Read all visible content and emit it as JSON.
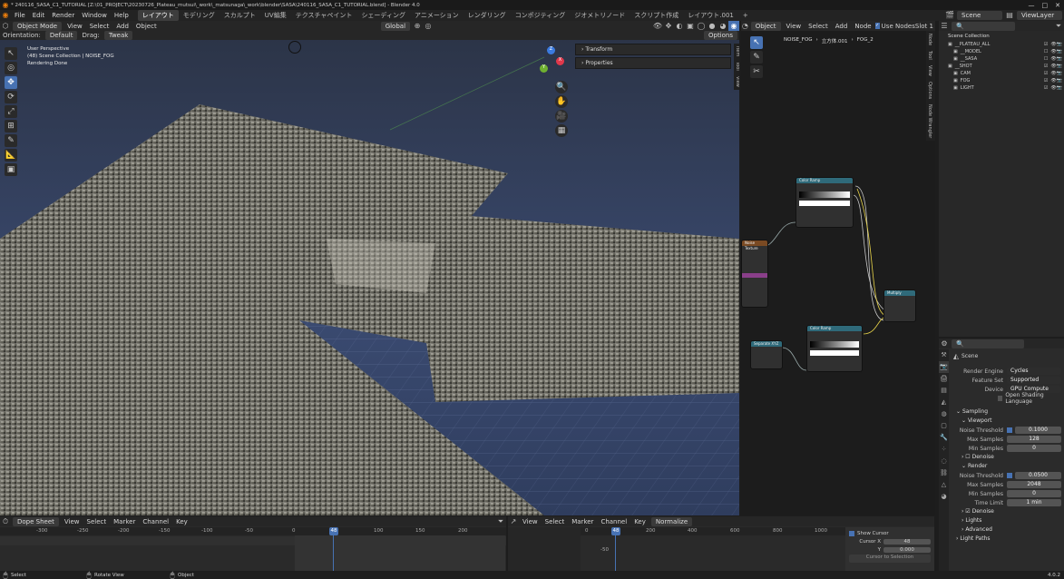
{
  "window_title": "* 240116_SASA_C1_TUTORIAL [Z:\\01_PROJECT\\20230726_Plateau_mutsui\\_work\\_matsunaga\\_work\\blender\\SASA\\240116_SASA_C1_TUTORIAL.blend] - Blender 4.0",
  "menu": [
    "File",
    "Edit",
    "Render",
    "Window",
    "Help"
  ],
  "workspaces": [
    "レイアウト",
    "モデリング",
    "スカルプト",
    "UV編集",
    "テクスチャペイント",
    "シェーディング",
    "アニメーション",
    "レンダリング",
    "コンポジティング",
    "ジオメトリノード",
    "スクリプト作成",
    "レイアウト.001"
  ],
  "active_workspace": "レイアウト",
  "add_ws": "+",
  "scene_name": "Scene",
  "view_layer": "ViewLayer",
  "viewport": {
    "mode": "Object Mode",
    "menus": [
      "View",
      "Select",
      "Add",
      "Object"
    ],
    "orientation_label": "Orientation:",
    "orientation": "Default",
    "drag_label": "Drag:",
    "drag": "Tweak",
    "transform_orient": "Global",
    "options": "Options",
    "info": [
      "User Perspective",
      "(48) Scene Collection | NOISE_FOG",
      "Rendering Done"
    ],
    "n_panels": [
      "Transform",
      "Properties"
    ],
    "side_tabs": [
      "Item",
      "Tool",
      "View"
    ],
    "tools": [
      "↖",
      "◎",
      "✥",
      "⟳",
      "⤢",
      "⊞",
      "✎",
      "📐",
      "▣"
    ],
    "gizmo": {
      "x": "X",
      "y": "Y",
      "z": "Z"
    },
    "nav": [
      "🔍",
      "✋",
      "🎥",
      "▦"
    ]
  },
  "node_editor": {
    "type": "Object",
    "menus": [
      "View",
      "Select",
      "Add",
      "Node"
    ],
    "use_nodes": "Use Nodes",
    "slot": "Slot 1",
    "breadcrumb": [
      "NOISE_FOG",
      "立方体.001",
      "FOG_2"
    ],
    "side_tabs": [
      "Node",
      "Tool",
      "View",
      "Options",
      "Node Wrangler"
    ],
    "nodes": [
      {
        "id": "cr1",
        "title": "Color Ramp",
        "color": "#2f6a7a"
      },
      {
        "id": "cr2",
        "title": "Color Ramp",
        "color": "#2f6a7a"
      },
      {
        "id": "noise",
        "title": "Noise Texture",
        "color": "#7a4a23"
      },
      {
        "id": "mat",
        "title": "Mapping",
        "color": "#2f5fa0"
      },
      {
        "id": "out",
        "title": "Multiply",
        "color": "#2f6a7a"
      },
      {
        "id": "coord",
        "title": "Separate XYZ",
        "color": "#2f6a7a"
      }
    ]
  },
  "outliner": {
    "header": "Scene Collection",
    "rows": [
      {
        "indent": 1,
        "name": "__PLATEAU_ALL",
        "checked": true
      },
      {
        "indent": 2,
        "name": "__MODEL",
        "checked": false
      },
      {
        "indent": 2,
        "name": "__SASA",
        "checked": false
      },
      {
        "indent": 1,
        "name": "__SHOT",
        "checked": true
      },
      {
        "indent": 2,
        "name": "CAM",
        "checked": true
      },
      {
        "indent": 2,
        "name": "FOG",
        "checked": true
      },
      {
        "indent": 2,
        "name": "LIGHT",
        "checked": true
      }
    ]
  },
  "properties": {
    "scene": "Scene",
    "render_engine_label": "Render Engine",
    "render_engine": "Cycles",
    "feature_set_label": "Feature Set",
    "feature_set": "Supported",
    "device_label": "Device",
    "device": "GPU Compute",
    "osl": "Open Shading Language",
    "sampling": "Sampling",
    "viewport": "Viewport",
    "vp_noise_label": "Noise Threshold",
    "vp_noise": "0.1000",
    "vp_max_label": "Max Samples",
    "vp_max": "128",
    "vp_min_label": "Min Samples",
    "vp_min": "0",
    "denoise1": "Denoise",
    "render": "Render",
    "r_noise_label": "Noise Threshold",
    "r_noise": "0.0500",
    "r_max_label": "Max Samples",
    "r_max": "2048",
    "r_min_label": "Min Samples",
    "r_min": "0",
    "r_time_label": "Time Limit",
    "r_time": "1 min",
    "denoise2": "Denoise",
    "lights": "Lights",
    "advanced": "Advanced",
    "light_paths": "Light Paths"
  },
  "dopesheet": {
    "mode": "Dope Sheet",
    "menus": [
      "View",
      "Select",
      "Marker",
      "Channel",
      "Key"
    ],
    "frame": "48",
    "ticks": [
      "-300",
      "-250",
      "-200",
      "-150",
      "-100",
      "-50",
      "0",
      "48",
      "100",
      "150",
      "200"
    ]
  },
  "graph": {
    "menus": [
      "View",
      "Select",
      "Marker",
      "Channel",
      "Key"
    ],
    "normalize": "Normalize",
    "frame": "48",
    "ticks": [
      "0",
      "48",
      "200",
      "400",
      "600",
      "800",
      "1000"
    ],
    "y_tick": "-50",
    "show_cursor": "Show Cursor",
    "cursor_x_label": "Cursor X",
    "cursor_x": "48",
    "cursor_y_label": "Y",
    "cursor_y": "0.000",
    "cursor_to_selection": "Cursor to Selection"
  },
  "status": {
    "select": "Select",
    "rotate": "Rotate View",
    "object": "Object",
    "version": "4.0.2"
  }
}
